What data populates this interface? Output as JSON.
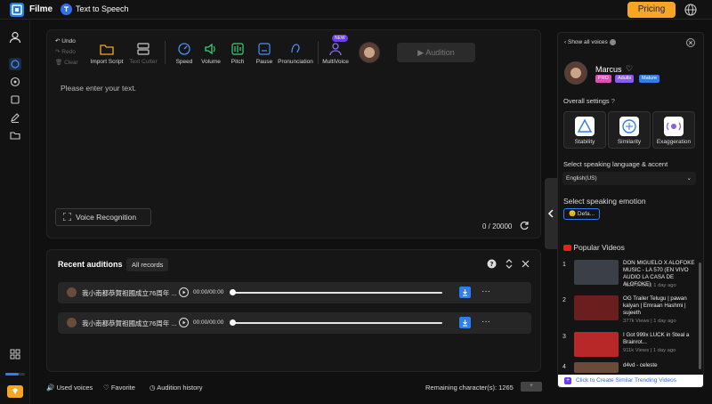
{
  "colors": {
    "accent": "#2f7df0",
    "pricing": "#f6a623",
    "tag_pro": "#e24fb4",
    "tag_adults": "#8a5cf0",
    "tag_mature": "#2f7df0",
    "youtube_red": "#e62117"
  },
  "header": {
    "brand": "Filme",
    "product": "Text to Speech",
    "pricing_label": "Pricing"
  },
  "toolbar": {
    "undo": "Undo",
    "redo": "Redo",
    "clear": "Clear",
    "import_script": "Import Script",
    "text_cutter": "Text Cutter",
    "speed": "Speed",
    "volume": "Volume",
    "pitch": "Pitch",
    "pause": "Pause",
    "pronunciation": "Pronunciation",
    "multivoice": "MultiVoice",
    "new_badge": "NEW",
    "audition": "Audition"
  },
  "editor": {
    "placeholder": "Please enter your text.",
    "voice_recognition": "Voice Recognition",
    "char_count": "0 / 20000"
  },
  "recent": {
    "title": "Recent auditions",
    "all_records": "All records",
    "items": [
      {
        "title": "我小南都恭賀祖國成立76周年 ...",
        "time": "00:00/00:00"
      },
      {
        "title": "我小南都恭賀祖國成立76周年 ...",
        "time": "00:00/00:00"
      }
    ]
  },
  "footer": {
    "used_voices": "Used voices",
    "favorite": "Favorite",
    "audition_history": "Audition history",
    "remaining": "Remaining character(s): 1265",
    "remaining_badge": "+"
  },
  "panel": {
    "show_all_voices": "Show all voices",
    "voice_name": "Marcus",
    "tags": [
      "PRO",
      "Adults",
      "Mature"
    ],
    "overall_settings": "Overall settings",
    "settings": [
      "Stability",
      "Similarity",
      "Exaggeration"
    ],
    "language_label": "Select speaking language & accent",
    "language_value": "English(US)",
    "emotion_label": "Select speaking emotion",
    "emotion_value": "😊 Defa...",
    "popular_videos": "Popular Videos",
    "videos": [
      {
        "rank": "1",
        "title": "DON MIGUELO X ALOFOKE MUSIC - LA 570 (EN VIVO AUDIO LA CASA DE ALOFOKE)",
        "meta": "482k Views | 1 day ago"
      },
      {
        "rank": "2",
        "title": "OG Trailer Telugu | pawan kalyan | Emraan Hashmi | sujeeth",
        "meta": "377k Views | 1 day ago"
      },
      {
        "rank": "3",
        "title": "I Got 999x LUCK in Steal a Brainrot...",
        "meta": "911k Views | 1 day ago"
      },
      {
        "rank": "4",
        "title": "d4vd - celeste",
        "meta": ""
      }
    ],
    "create_trending": "Click to Create Similar Trending Videos"
  }
}
